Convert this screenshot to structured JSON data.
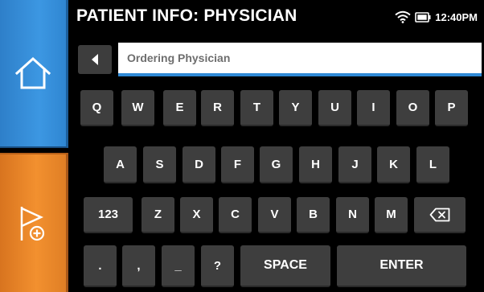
{
  "header": {
    "title": "PATIENT INFO: PHYSICIAN",
    "time": "12:40PM"
  },
  "status_icons": [
    "wifi-icon",
    "battery-icon"
  ],
  "input": {
    "placeholder": "Ordering Physician"
  },
  "keyboard": {
    "row1": [
      "Q",
      "W",
      "E",
      "R",
      "T",
      "Y",
      "U",
      "I",
      "O",
      "P"
    ],
    "row2": [
      "A",
      "S",
      "D",
      "F",
      "G",
      "H",
      "J",
      "K",
      "L"
    ],
    "row3": [
      "123",
      "Z",
      "X",
      "C",
      "V",
      "B",
      "N",
      "M"
    ],
    "row4": [
      ".",
      ",",
      "_",
      "?"
    ],
    "space": "SPACE",
    "enter": "ENTER"
  },
  "sidebar": {
    "home_icon": "home-icon",
    "flag_icon": "flag-add-icon"
  },
  "colors": {
    "home_button": "#3a93df",
    "flag_button": "#ef8c2c",
    "key": "#3e3e3e",
    "input_underline": "#2f8ad6"
  }
}
